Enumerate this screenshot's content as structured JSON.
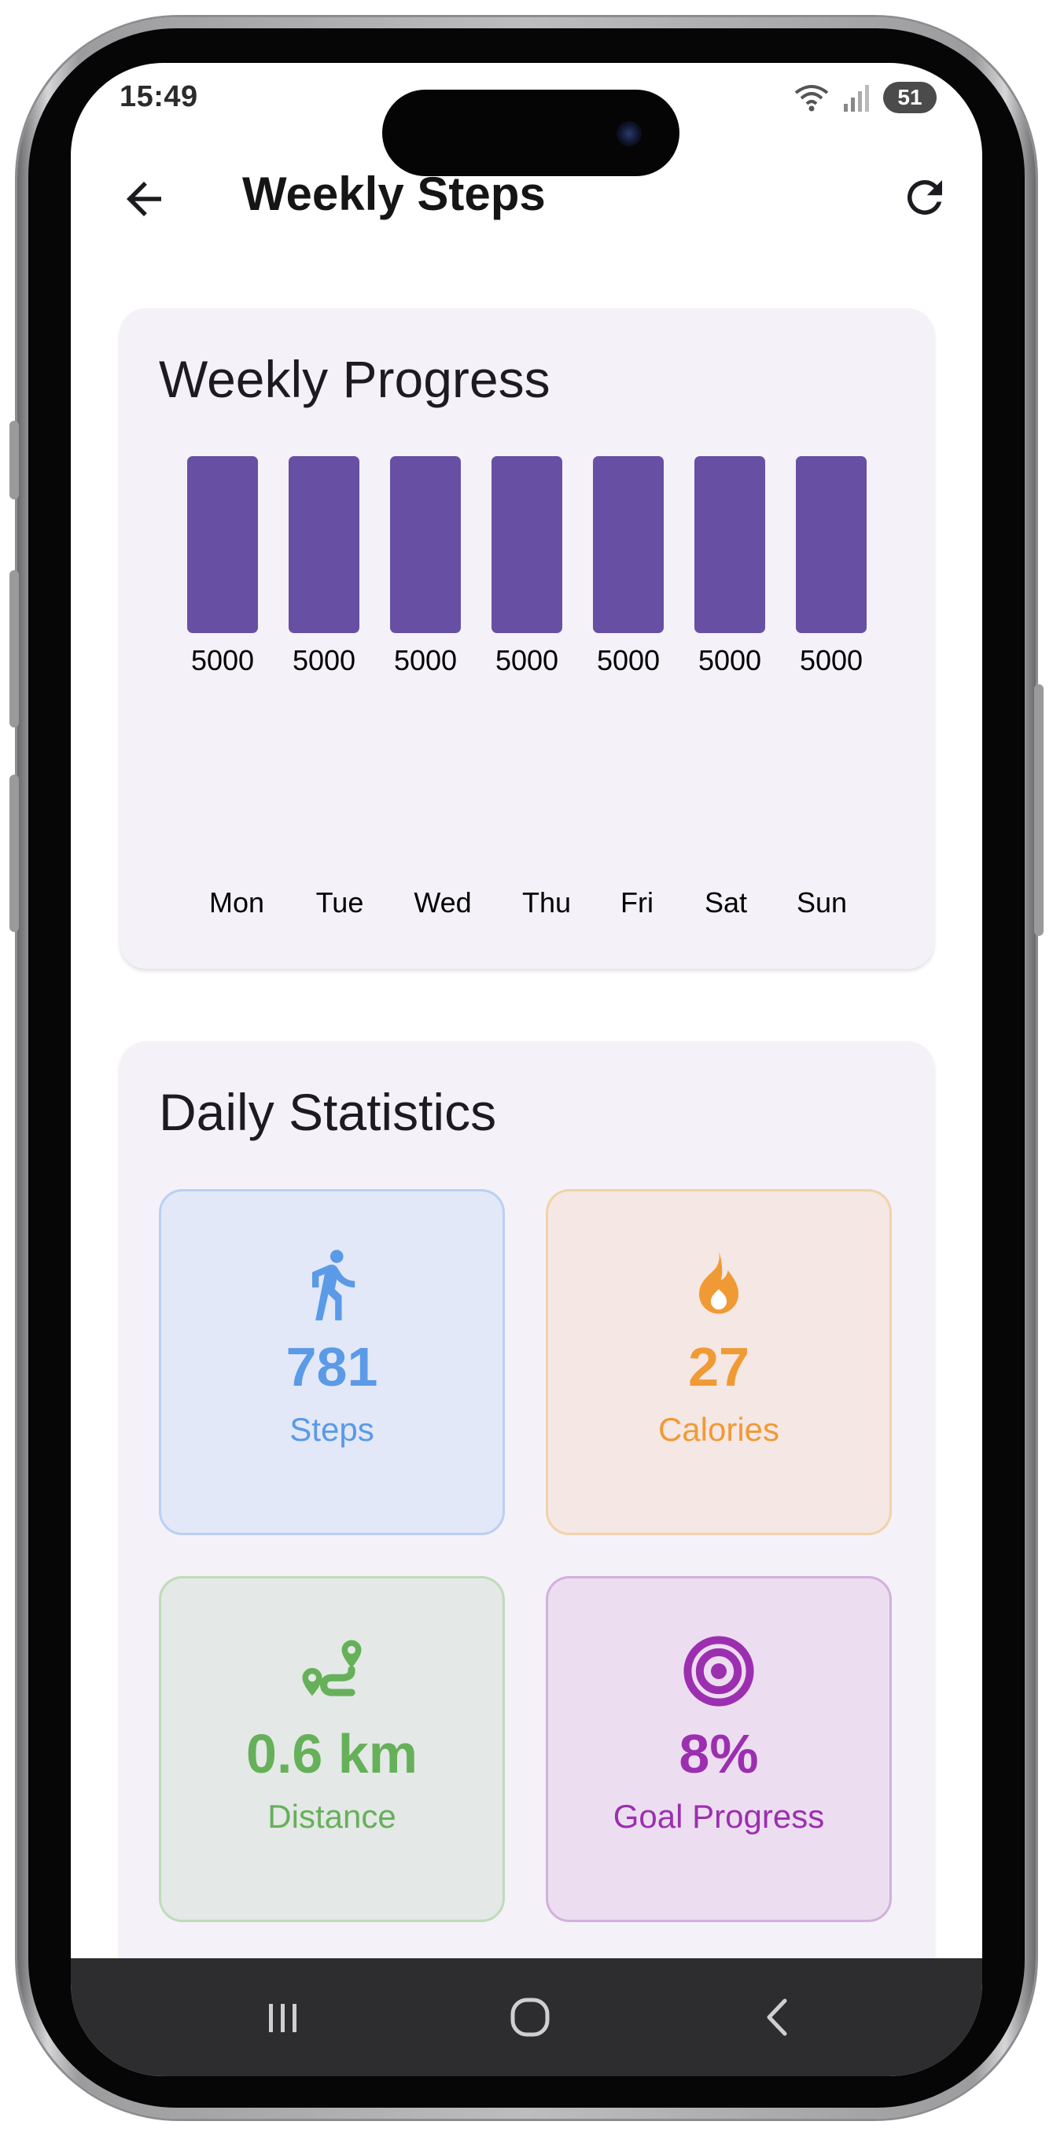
{
  "status_bar": {
    "time": "15:49",
    "battery": "51"
  },
  "app_bar": {
    "title": "Weekly Steps"
  },
  "weekly_progress": {
    "title": "Weekly Progress",
    "chart_data": {
      "type": "bar",
      "categories": [
        "Mon",
        "Tue",
        "Wed",
        "Thu",
        "Fri",
        "Sat",
        "Sun"
      ],
      "values": [
        5000,
        5000,
        5000,
        5000,
        5000,
        5000,
        5000
      ],
      "value_labels": [
        "5000",
        "5000",
        "5000",
        "5000",
        "5000",
        "5000",
        "5000"
      ],
      "ylim": [
        0,
        5000
      ],
      "bar_color": "#6750a4",
      "grid": false
    }
  },
  "daily_statistics": {
    "title": "Daily Statistics",
    "tiles": [
      {
        "value": "781",
        "label": "Steps",
        "icon": "walking-icon",
        "color": "#5b9ae6",
        "bg": "#e2e8f8",
        "border": "#b9d0f2"
      },
      {
        "value": "27",
        "label": "Calories",
        "icon": "flame-icon",
        "color": "#f09a36",
        "bg": "#f5e7e3",
        "border": "#f2d2a8"
      },
      {
        "value": "0.6 km",
        "label": "Distance",
        "icon": "route-icon",
        "color": "#66b05a",
        "bg": "#e4e8e6",
        "border": "#bedcb8"
      },
      {
        "value": "8%",
        "label": "Goal Progress",
        "icon": "target-icon",
        "color": "#9c2fb0",
        "bg": "#ecdef0",
        "border": "#d2b0dc"
      }
    ]
  }
}
